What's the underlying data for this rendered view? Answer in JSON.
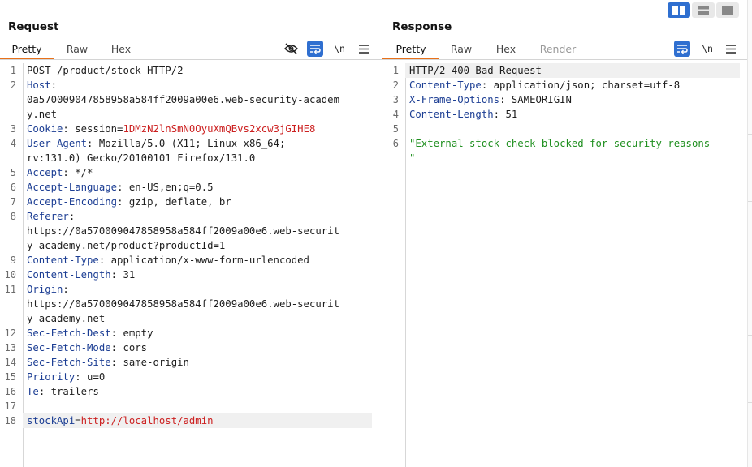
{
  "request": {
    "title": "Request",
    "tabs": [
      "Pretty",
      "Raw",
      "Hex"
    ],
    "active_tab": "Pretty",
    "toolbar": {
      "newline_label": "\\n",
      "icons": [
        "eye-slash-icon",
        "wrap-lines-icon",
        "newline-toggle",
        "hamburger-menu-icon"
      ]
    },
    "lines": [
      {
        "n": "1",
        "plain": "POST /product/stock HTTP/2"
      },
      {
        "n": "2",
        "key": "Host",
        "val": ""
      },
      {
        "n": "",
        "plain": "0a570009047858958a584ff2009a00e6.web-security-academ"
      },
      {
        "n": "",
        "plain": "y.net"
      },
      {
        "n": "3",
        "key": "Cookie",
        "val": " session=",
        "red": "1DMzN2lnSmN0OyuXmQBvs2xcw3jGIHE8"
      },
      {
        "n": "4",
        "key": "User-Agent",
        "val": " Mozilla/5.0 (X11; Linux x86_64;"
      },
      {
        "n": "",
        "plain": "rv:131.0) Gecko/20100101 Firefox/131.0"
      },
      {
        "n": "5",
        "key": "Accept",
        "val": " */*"
      },
      {
        "n": "6",
        "key": "Accept-Language",
        "val": " en-US,en;q=0.5"
      },
      {
        "n": "7",
        "key": "Accept-Encoding",
        "val": " gzip, deflate, br"
      },
      {
        "n": "8",
        "key": "Referer",
        "val": ""
      },
      {
        "n": "",
        "plain": "https://0a570009047858958a584ff2009a00e6.web-securit"
      },
      {
        "n": "",
        "plain": "y-academy.net/product?productId=1"
      },
      {
        "n": "9",
        "key": "Content-Type",
        "val": " application/x-www-form-urlencoded"
      },
      {
        "n": "10",
        "key": "Content-Length",
        "val": " 31"
      },
      {
        "n": "11",
        "key": "Origin",
        "val": ""
      },
      {
        "n": "",
        "plain": "https://0a570009047858958a584ff2009a00e6.web-securit"
      },
      {
        "n": "",
        "plain": "y-academy.net"
      },
      {
        "n": "12",
        "key": "Sec-Fetch-Dest",
        "val": " empty"
      },
      {
        "n": "13",
        "key": "Sec-Fetch-Mode",
        "val": " cors"
      },
      {
        "n": "14",
        "key": "Sec-Fetch-Site",
        "val": " same-origin"
      },
      {
        "n": "15",
        "key": "Priority",
        "val": " u=0"
      },
      {
        "n": "16",
        "key": "Te",
        "val": " trailers"
      },
      {
        "n": "17",
        "plain": ""
      },
      {
        "n": "18",
        "param": "stockApi",
        "eq": "=",
        "red": "http://localhost/admin",
        "caret": true,
        "highlight": true
      }
    ]
  },
  "response": {
    "title": "Response",
    "tabs": [
      "Pretty",
      "Raw",
      "Hex",
      "Render"
    ],
    "active_tab": "Pretty",
    "toolbar": {
      "newline_label": "\\n",
      "icons": [
        "wrap-lines-icon",
        "newline-toggle",
        "hamburger-menu-icon"
      ]
    },
    "lines": [
      {
        "n": "1",
        "plain": "HTTP/2 400 Bad Request",
        "highlight": true
      },
      {
        "n": "2",
        "key": "Content-Type",
        "val": " application/json; charset=utf-8"
      },
      {
        "n": "3",
        "key": "X-Frame-Options",
        "val": " SAMEORIGIN"
      },
      {
        "n": "4",
        "key": "Content-Length",
        "val": " 51"
      },
      {
        "n": "5",
        "plain": ""
      },
      {
        "n": "6",
        "green": "\"External stock check blocked for security reasons"
      },
      {
        "n": "",
        "green": "\""
      }
    ]
  },
  "layout_toggle": {
    "options": [
      "side-by-side",
      "top-bottom",
      "tabs"
    ],
    "active": "side-by-side"
  },
  "colors": {
    "accent": "#e8711a",
    "selected_blue": "#2f6fd0",
    "header_key": "#1b3d93",
    "cookie_value": "#cc2020",
    "string": "#1f8f1f"
  }
}
